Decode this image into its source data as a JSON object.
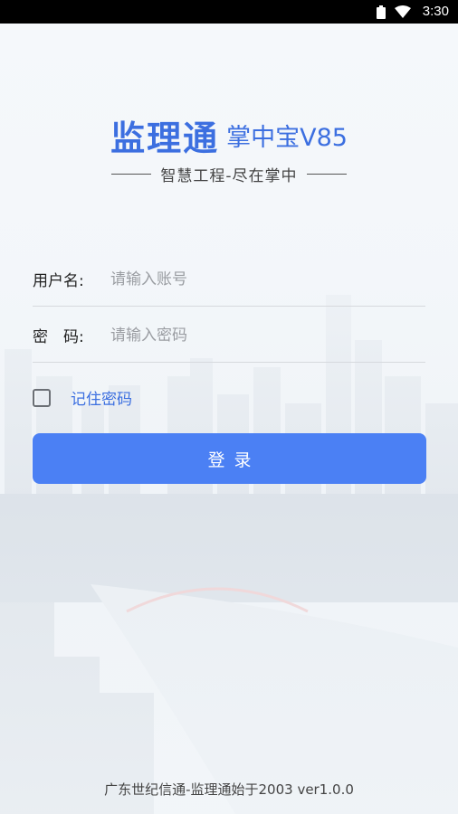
{
  "status_bar": {
    "time": "3:30",
    "wifi_icon": "wifi-icon",
    "battery_icon": "battery-icon"
  },
  "brand": {
    "title": "监理通",
    "subtitle": "掌中宝V85",
    "slogan": "智慧工程-尽在掌中"
  },
  "form": {
    "username": {
      "label": "用户名:",
      "placeholder": "请输入账号",
      "value": ""
    },
    "password": {
      "label": "密　码:",
      "placeholder": "请输入密码",
      "value": ""
    },
    "remember": {
      "label": "记住密码",
      "checked": false
    },
    "login_button": "登录"
  },
  "footer": "广东世纪信通-监理通始于2003 ver1.0.0",
  "colors": {
    "accent": "#4b80f4",
    "title": "#3c6fe0",
    "status_bar": "#000000"
  }
}
